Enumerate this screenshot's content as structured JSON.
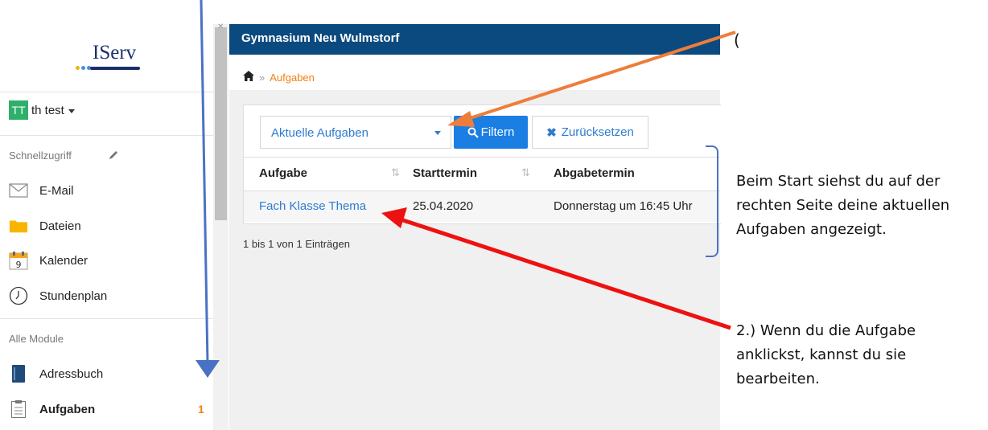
{
  "logo": {
    "text": "IServ"
  },
  "user": {
    "initials": "TT",
    "name": "th test"
  },
  "quick_access": {
    "label": "Schnellzugriff"
  },
  "nav_items": [
    {
      "label": "E-Mail",
      "icon": "mail-icon"
    },
    {
      "label": "Dateien",
      "icon": "folder-icon"
    },
    {
      "label": "Kalender",
      "icon": "calendar-icon"
    },
    {
      "label": "Stundenplan",
      "icon": "clock-icon"
    }
  ],
  "calendar_day": "9",
  "all_modules": {
    "label": "Alle Module"
  },
  "modules": [
    {
      "label": "Adressbuch",
      "icon": "addressbook-icon"
    },
    {
      "label": "Aufgaben",
      "icon": "tasks-icon",
      "badge": "1"
    }
  ],
  "header": {
    "title": "Gymnasium Neu Wulmstorf"
  },
  "breadcrumb": {
    "separator": "»",
    "current": "Aufgaben"
  },
  "filter": {
    "select_value": "Aktuelle Aufgaben",
    "filter_label": "Filtern",
    "reset_label": "Zurücksetzen"
  },
  "table": {
    "columns": [
      "Aufgabe",
      "Starttermin",
      "Abgabetermin"
    ],
    "rows": [
      {
        "task": "Fach Klasse Thema",
        "start": "25.04.2020",
        "due": "Donnerstag um 16:45 Uhr"
      }
    ],
    "count_text": "1 bis 1 von 1 Einträgen"
  },
  "annotations": {
    "paren": "(",
    "note1": [
      "Beim Start siehst du auf der",
      "rechten Seite deine aktuellen",
      "Aufgaben angezeigt."
    ],
    "note2": [
      "2.)  Wenn du die Aufgabe",
      "anklickst, kannst du sie",
      "bearbeiten."
    ]
  },
  "colors": {
    "header": "#0b4a7e",
    "accent_orange": "#f0820f",
    "link_blue": "#2e7bd0",
    "filter_button": "#1a7ee3",
    "arrow_blue": "#4a72c4",
    "arrow_orange": "#ee7d3b",
    "arrow_red": "#ee1111",
    "avatar": "#2eb06a"
  }
}
